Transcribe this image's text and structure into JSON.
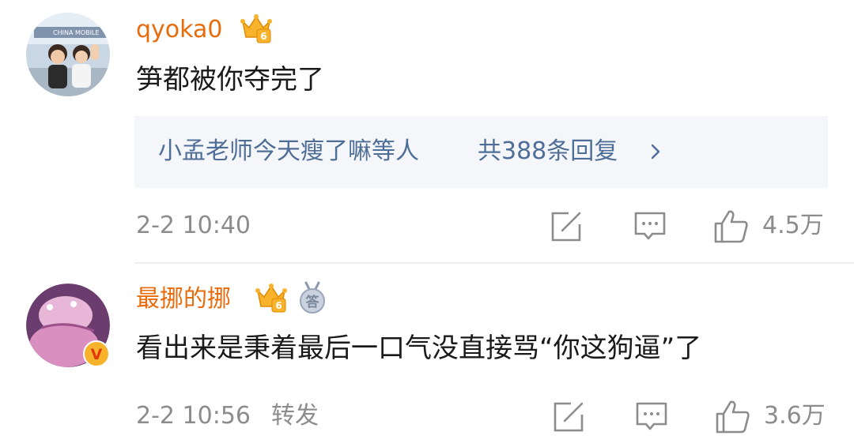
{
  "comments": [
    {
      "username": "qyoka0",
      "text": "笋都被你夺完了",
      "replies_preview": {
        "names": "小孟老师今天瘦了嘛等人",
        "count_label": "共388条回复"
      },
      "timestamp": "2-2 10:40",
      "likes": "4.5万",
      "level_badge": "6",
      "avatar_caption": "CHINA MOBILE"
    },
    {
      "username": "最挪的挪",
      "text": "看出来是秉着最后一口气没直接骂“你这狗逼”了",
      "timestamp": "2-2 10:56",
      "repost_label": "转发",
      "likes": "3.6万",
      "level_badge": "6",
      "answer_badge": "答",
      "verified_mark": "V"
    }
  ],
  "colors": {
    "username": "#e86b0c",
    "link": "#4f6e97",
    "meta": "#8c8c8c",
    "reply_bg": "#f4f6fa",
    "crown": "#f7b32b"
  },
  "icons": [
    "crown-level-icon",
    "chevron-right-icon",
    "share-icon",
    "comment-icon",
    "thumbs-up-icon",
    "answer-medal-icon",
    "verified-v-icon"
  ]
}
